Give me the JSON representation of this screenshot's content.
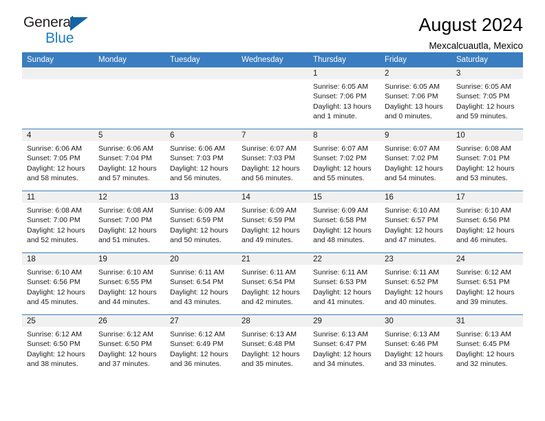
{
  "brand": {
    "name_part1": "General",
    "name_part2": "Blue",
    "flag_icon": "triangle-flag-icon"
  },
  "header": {
    "title": "August 2024",
    "location": "Mexcalcuautla, Mexico"
  },
  "weekday_headers": [
    "Sunday",
    "Monday",
    "Tuesday",
    "Wednesday",
    "Thursday",
    "Friday",
    "Saturday"
  ],
  "labels": {
    "sunrise": "Sunrise:",
    "sunset": "Sunset:",
    "daylight": "Daylight:"
  },
  "colors": {
    "header_blue": "#3a7dc0",
    "brand_blue": "#1d7dc4",
    "flag_blue": "#1464a5",
    "daynum_bg": "#f0f0f0"
  },
  "weeks": [
    [
      {
        "day": "",
        "lines": []
      },
      {
        "day": "",
        "lines": []
      },
      {
        "day": "",
        "lines": []
      },
      {
        "day": "",
        "lines": []
      },
      {
        "day": "1",
        "lines": [
          "Sunrise: 6:05 AM",
          "Sunset: 7:06 PM",
          "Daylight: 13 hours",
          "and 1 minute."
        ]
      },
      {
        "day": "2",
        "lines": [
          "Sunrise: 6:05 AM",
          "Sunset: 7:06 PM",
          "Daylight: 13 hours",
          "and 0 minutes."
        ]
      },
      {
        "day": "3",
        "lines": [
          "Sunrise: 6:05 AM",
          "Sunset: 7:05 PM",
          "Daylight: 12 hours",
          "and 59 minutes."
        ]
      }
    ],
    [
      {
        "day": "4",
        "lines": [
          "Sunrise: 6:06 AM",
          "Sunset: 7:05 PM",
          "Daylight: 12 hours",
          "and 58 minutes."
        ]
      },
      {
        "day": "5",
        "lines": [
          "Sunrise: 6:06 AM",
          "Sunset: 7:04 PM",
          "Daylight: 12 hours",
          "and 57 minutes."
        ]
      },
      {
        "day": "6",
        "lines": [
          "Sunrise: 6:06 AM",
          "Sunset: 7:03 PM",
          "Daylight: 12 hours",
          "and 56 minutes."
        ]
      },
      {
        "day": "7",
        "lines": [
          "Sunrise: 6:07 AM",
          "Sunset: 7:03 PM",
          "Daylight: 12 hours",
          "and 56 minutes."
        ]
      },
      {
        "day": "8",
        "lines": [
          "Sunrise: 6:07 AM",
          "Sunset: 7:02 PM",
          "Daylight: 12 hours",
          "and 55 minutes."
        ]
      },
      {
        "day": "9",
        "lines": [
          "Sunrise: 6:07 AM",
          "Sunset: 7:02 PM",
          "Daylight: 12 hours",
          "and 54 minutes."
        ]
      },
      {
        "day": "10",
        "lines": [
          "Sunrise: 6:08 AM",
          "Sunset: 7:01 PM",
          "Daylight: 12 hours",
          "and 53 minutes."
        ]
      }
    ],
    [
      {
        "day": "11",
        "lines": [
          "Sunrise: 6:08 AM",
          "Sunset: 7:00 PM",
          "Daylight: 12 hours",
          "and 52 minutes."
        ]
      },
      {
        "day": "12",
        "lines": [
          "Sunrise: 6:08 AM",
          "Sunset: 7:00 PM",
          "Daylight: 12 hours",
          "and 51 minutes."
        ]
      },
      {
        "day": "13",
        "lines": [
          "Sunrise: 6:09 AM",
          "Sunset: 6:59 PM",
          "Daylight: 12 hours",
          "and 50 minutes."
        ]
      },
      {
        "day": "14",
        "lines": [
          "Sunrise: 6:09 AM",
          "Sunset: 6:59 PM",
          "Daylight: 12 hours",
          "and 49 minutes."
        ]
      },
      {
        "day": "15",
        "lines": [
          "Sunrise: 6:09 AM",
          "Sunset: 6:58 PM",
          "Daylight: 12 hours",
          "and 48 minutes."
        ]
      },
      {
        "day": "16",
        "lines": [
          "Sunrise: 6:10 AM",
          "Sunset: 6:57 PM",
          "Daylight: 12 hours",
          "and 47 minutes."
        ]
      },
      {
        "day": "17",
        "lines": [
          "Sunrise: 6:10 AM",
          "Sunset: 6:56 PM",
          "Daylight: 12 hours",
          "and 46 minutes."
        ]
      }
    ],
    [
      {
        "day": "18",
        "lines": [
          "Sunrise: 6:10 AM",
          "Sunset: 6:56 PM",
          "Daylight: 12 hours",
          "and 45 minutes."
        ]
      },
      {
        "day": "19",
        "lines": [
          "Sunrise: 6:10 AM",
          "Sunset: 6:55 PM",
          "Daylight: 12 hours",
          "and 44 minutes."
        ]
      },
      {
        "day": "20",
        "lines": [
          "Sunrise: 6:11 AM",
          "Sunset: 6:54 PM",
          "Daylight: 12 hours",
          "and 43 minutes."
        ]
      },
      {
        "day": "21",
        "lines": [
          "Sunrise: 6:11 AM",
          "Sunset: 6:54 PM",
          "Daylight: 12 hours",
          "and 42 minutes."
        ]
      },
      {
        "day": "22",
        "lines": [
          "Sunrise: 6:11 AM",
          "Sunset: 6:53 PM",
          "Daylight: 12 hours",
          "and 41 minutes."
        ]
      },
      {
        "day": "23",
        "lines": [
          "Sunrise: 6:11 AM",
          "Sunset: 6:52 PM",
          "Daylight: 12 hours",
          "and 40 minutes."
        ]
      },
      {
        "day": "24",
        "lines": [
          "Sunrise: 6:12 AM",
          "Sunset: 6:51 PM",
          "Daylight: 12 hours",
          "and 39 minutes."
        ]
      }
    ],
    [
      {
        "day": "25",
        "lines": [
          "Sunrise: 6:12 AM",
          "Sunset: 6:50 PM",
          "Daylight: 12 hours",
          "and 38 minutes."
        ]
      },
      {
        "day": "26",
        "lines": [
          "Sunrise: 6:12 AM",
          "Sunset: 6:50 PM",
          "Daylight: 12 hours",
          "and 37 minutes."
        ]
      },
      {
        "day": "27",
        "lines": [
          "Sunrise: 6:12 AM",
          "Sunset: 6:49 PM",
          "Daylight: 12 hours",
          "and 36 minutes."
        ]
      },
      {
        "day": "28",
        "lines": [
          "Sunrise: 6:13 AM",
          "Sunset: 6:48 PM",
          "Daylight: 12 hours",
          "and 35 minutes."
        ]
      },
      {
        "day": "29",
        "lines": [
          "Sunrise: 6:13 AM",
          "Sunset: 6:47 PM",
          "Daylight: 12 hours",
          "and 34 minutes."
        ]
      },
      {
        "day": "30",
        "lines": [
          "Sunrise: 6:13 AM",
          "Sunset: 6:46 PM",
          "Daylight: 12 hours",
          "and 33 minutes."
        ]
      },
      {
        "day": "31",
        "lines": [
          "Sunrise: 6:13 AM",
          "Sunset: 6:45 PM",
          "Daylight: 12 hours",
          "and 32 minutes."
        ]
      }
    ]
  ]
}
